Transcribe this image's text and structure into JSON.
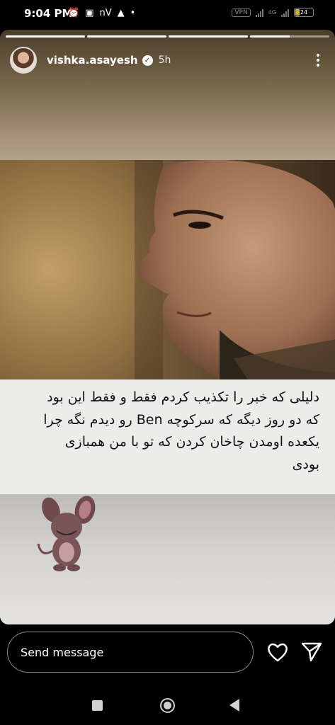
{
  "status_bar": {
    "time": "9:04 PM",
    "left_text": "nV",
    "vpn": "VPN",
    "network": "4G",
    "battery_level": "24"
  },
  "story": {
    "segments": [
      1,
      1,
      1,
      0.5
    ],
    "username": "vishka.asayesh",
    "time_ago": "5h",
    "caption_lines": [
      "دلیلی که خبر را تکذیب کردم فقط و فقط این بود",
      "که دو روز دیگه که سرکوچه Ben رو دیدم نگه چرا",
      "یکعده اومدن چاخان کردن که تو با من همبازی",
      "بودی"
    ]
  },
  "bottom_bar": {
    "message_placeholder": "Send message"
  },
  "icons": {
    "heart": "heart-icon",
    "send": "send-icon",
    "more": "more-icon",
    "verified": "verified-icon"
  }
}
